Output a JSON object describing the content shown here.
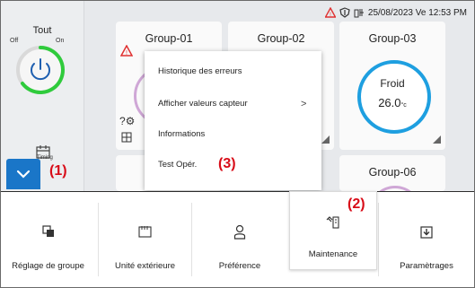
{
  "status": {
    "datetime": "25/08/2023 Ve 12:53 PM"
  },
  "left_panel": {
    "title": "Tout",
    "off_label": "Off",
    "on_label": "On",
    "timing_label": "Timing"
  },
  "groups": [
    {
      "name": "Group-01"
    },
    {
      "name": "Group-02"
    },
    {
      "name": "Group-03",
      "mode": "Froid",
      "temp": "26.0",
      "unit": "°c",
      "ring_color": "#1e9fe0"
    },
    {
      "name": "Group-06"
    }
  ],
  "popup_menu": {
    "items": [
      {
        "label": "Historique des erreurs"
      },
      {
        "label": "Afficher valeurs capteur"
      },
      {
        "label": "Informations"
      },
      {
        "label": "Test Opér."
      }
    ],
    "submenu_arrow": ">"
  },
  "callouts": {
    "one": "(1)",
    "two": "(2)",
    "three": "(3)"
  },
  "toolbar": {
    "items": [
      {
        "label": "Réglage de groupe"
      },
      {
        "label": "Unité extérieure"
      },
      {
        "label": "Préférence"
      },
      {
        "label": "Maintenance"
      },
      {
        "label": "Paramètrages"
      }
    ]
  },
  "colors": {
    "fab": "#1a76c8",
    "power_ring": "#2fcb3c",
    "callout": "#d80c18",
    "alert": "#e03131"
  }
}
